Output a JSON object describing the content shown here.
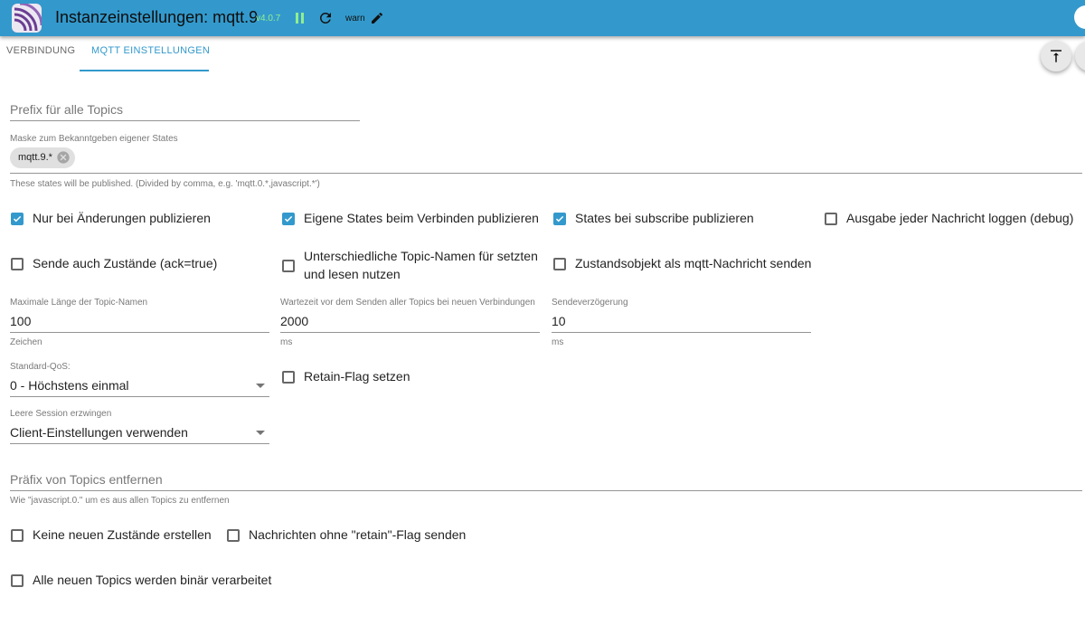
{
  "header": {
    "title": "Instanzeinstellungen: mqtt.9",
    "version": "v4.0.7",
    "log_level": "warn",
    "color": "#3399cc"
  },
  "tabs": [
    {
      "label": "VERBINDUNG",
      "active": false
    },
    {
      "label": "MQTT EINSTELLUNGEN",
      "active": true
    }
  ],
  "fields": {
    "prefix": {
      "label": "Prefix für alle Topics",
      "value": ""
    },
    "mask": {
      "label": "Maske zum Bekanntgeben eigener States",
      "chip": "mqtt.9.*",
      "helper": "These states will be published. (Divided by comma, e.g. 'mqtt.0.*,javascript.*')"
    },
    "max_len": {
      "label": "Maximale Länge der Topic-Namen",
      "value": "100",
      "helper": "Zeichen"
    },
    "wait": {
      "label": "Wartezeit vor dem Senden aller Topics bei neuen Verbindungen",
      "value": "2000",
      "helper": "ms"
    },
    "send_delay": {
      "label": "Sendeverzögerung",
      "value": "10",
      "helper": "ms"
    },
    "qos": {
      "label": "Standard-QoS:",
      "value": "0 - Höchstens einmal"
    },
    "clean_session": {
      "label": "Leere Session erzwingen",
      "value": "Client-Einstellungen verwenden"
    },
    "remove_prefix": {
      "label": "Präfix von Topics entfernen",
      "value": "",
      "helper": "Wie \"javascript.0.\" um es aus allen Topics zu entfernen"
    }
  },
  "checkboxes": {
    "only_changes": {
      "label": "Nur bei Änderungen publizieren",
      "checked": true
    },
    "publish_on_connect": {
      "label": "Eigene States beim Verbinden publizieren",
      "checked": true
    },
    "publish_on_subscribe": {
      "label": "States bei subscribe publizieren",
      "checked": true
    },
    "debug_log": {
      "label": "Ausgabe jeder Nachricht loggen (debug)",
      "checked": false
    },
    "send_ack_true": {
      "label": "Sende auch Zustände (ack=true)",
      "checked": false
    },
    "different_topic_names_line1": {
      "label": "Unterschiedliche Topic-Namen für setzten",
      "checked": false
    },
    "different_topic_names_line2": {
      "label": "und lesen nutzen"
    },
    "state_object": {
      "label": "Zustandsobjekt als mqtt-Nachricht senden",
      "checked": false
    },
    "retain_flag": {
      "label": "Retain-Flag setzen",
      "checked": false
    },
    "no_new_states": {
      "label": "Keine neuen Zustände erstellen",
      "checked": false
    },
    "no_retain": {
      "label": "Nachrichten ohne \"retain\"-Flag senden",
      "checked": false
    },
    "binary": {
      "label": "Alle neuen Topics werden binär verarbeitet",
      "checked": false
    }
  }
}
